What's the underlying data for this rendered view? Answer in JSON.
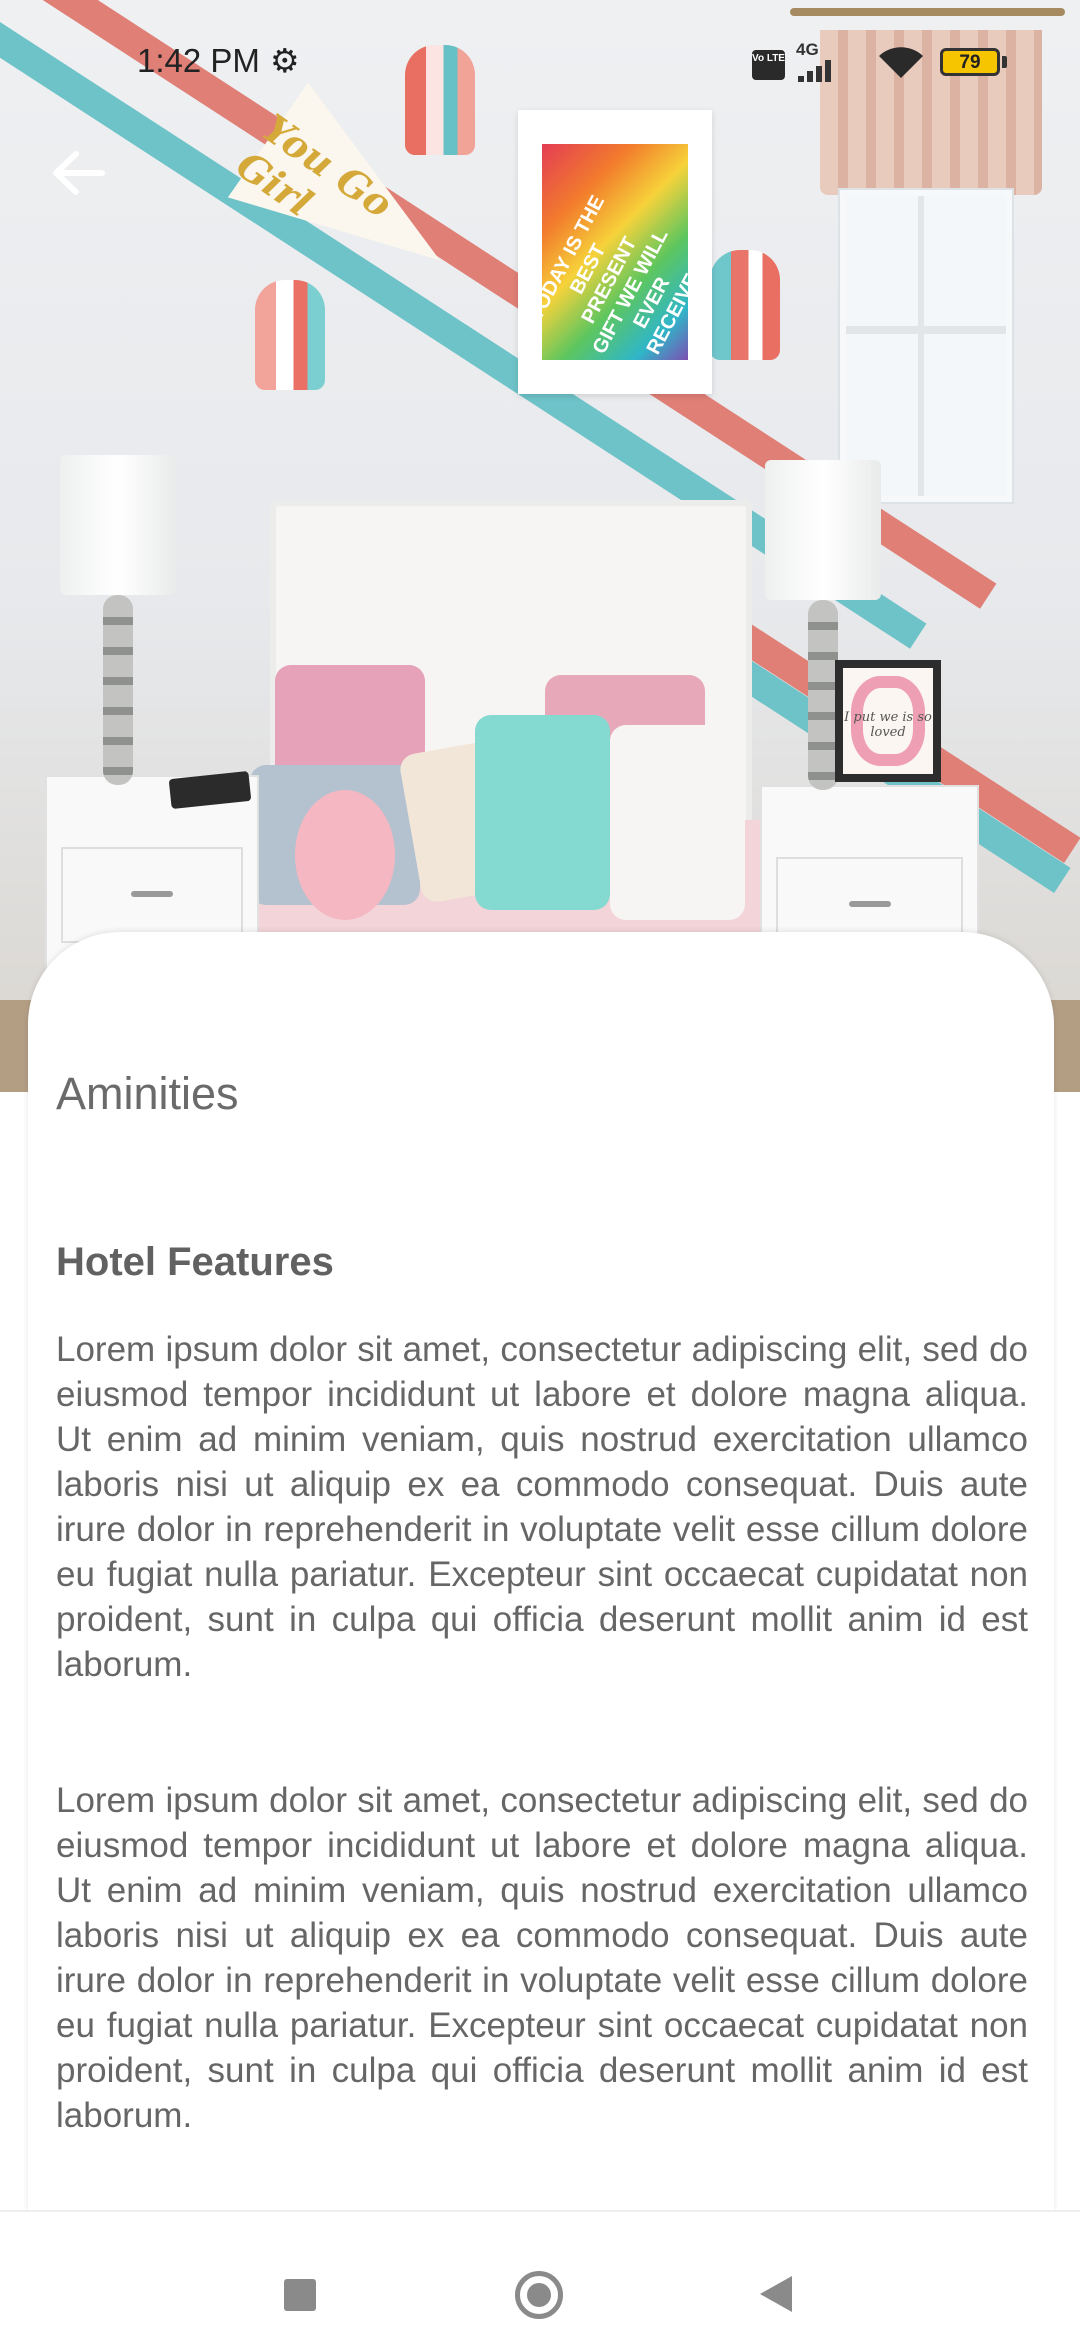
{
  "status_bar": {
    "time": "1:42 PM",
    "icons": [
      "gear-icon",
      "volte-icon",
      "signal-icon",
      "wifi-icon",
      "battery-icon"
    ],
    "volte_label": "Vo LTE",
    "network_label": "4G",
    "battery_level": "79"
  },
  "hero": {
    "image": "kids-bedroom-photo",
    "pennant_text": "You Go Girl",
    "poster_text": "TODAY IS THE BEST PRESENT GIFT WE WILL EVER RECEIVE",
    "frame_text": "I put we is so loved"
  },
  "toolbar": {
    "back_icon": "arrow-left-icon"
  },
  "content": {
    "section_title": "Aminities",
    "subtitle": "Hotel Features",
    "paragraphs": [
      "Lorem ipsum dolor sit amet, consectetur adipiscing elit, sed do eiusmod tempor incididunt ut labore et dolore magna aliqua. Ut enim ad minim veniam, quis nostrud exercitation ullamco laboris nisi ut aliquip ex ea commodo consequat. Duis aute irure dolor in reprehenderit in voluptate velit esse cillum dolore eu fugiat nulla pariatur. Excepteur sint occaecat cupidatat non proident, sunt in culpa qui officia deserunt mollit anim id est laborum.",
      "Lorem ipsum dolor sit amet, consectetur adipiscing elit, sed do eiusmod tempor incididunt ut labore et dolore magna aliqua. Ut enim ad minim veniam, quis nostrud exercitation ullamco laboris nisi ut aliquip ex ea commodo consequat. Duis aute irure dolor in reprehenderit in voluptate velit esse cillum dolore eu fugiat nulla pariatur. Excepteur sint occaecat cupidatat non proident, sunt in culpa qui officia deserunt mollit anim id est laborum."
    ]
  },
  "nav_bar": {
    "buttons": [
      "recent-apps-icon",
      "home-icon",
      "back-icon"
    ]
  },
  "colors": {
    "text_primary": "#616161",
    "text_body": "#666666",
    "nav_icon": "#8a8a8a",
    "battery": "#f7c400"
  }
}
